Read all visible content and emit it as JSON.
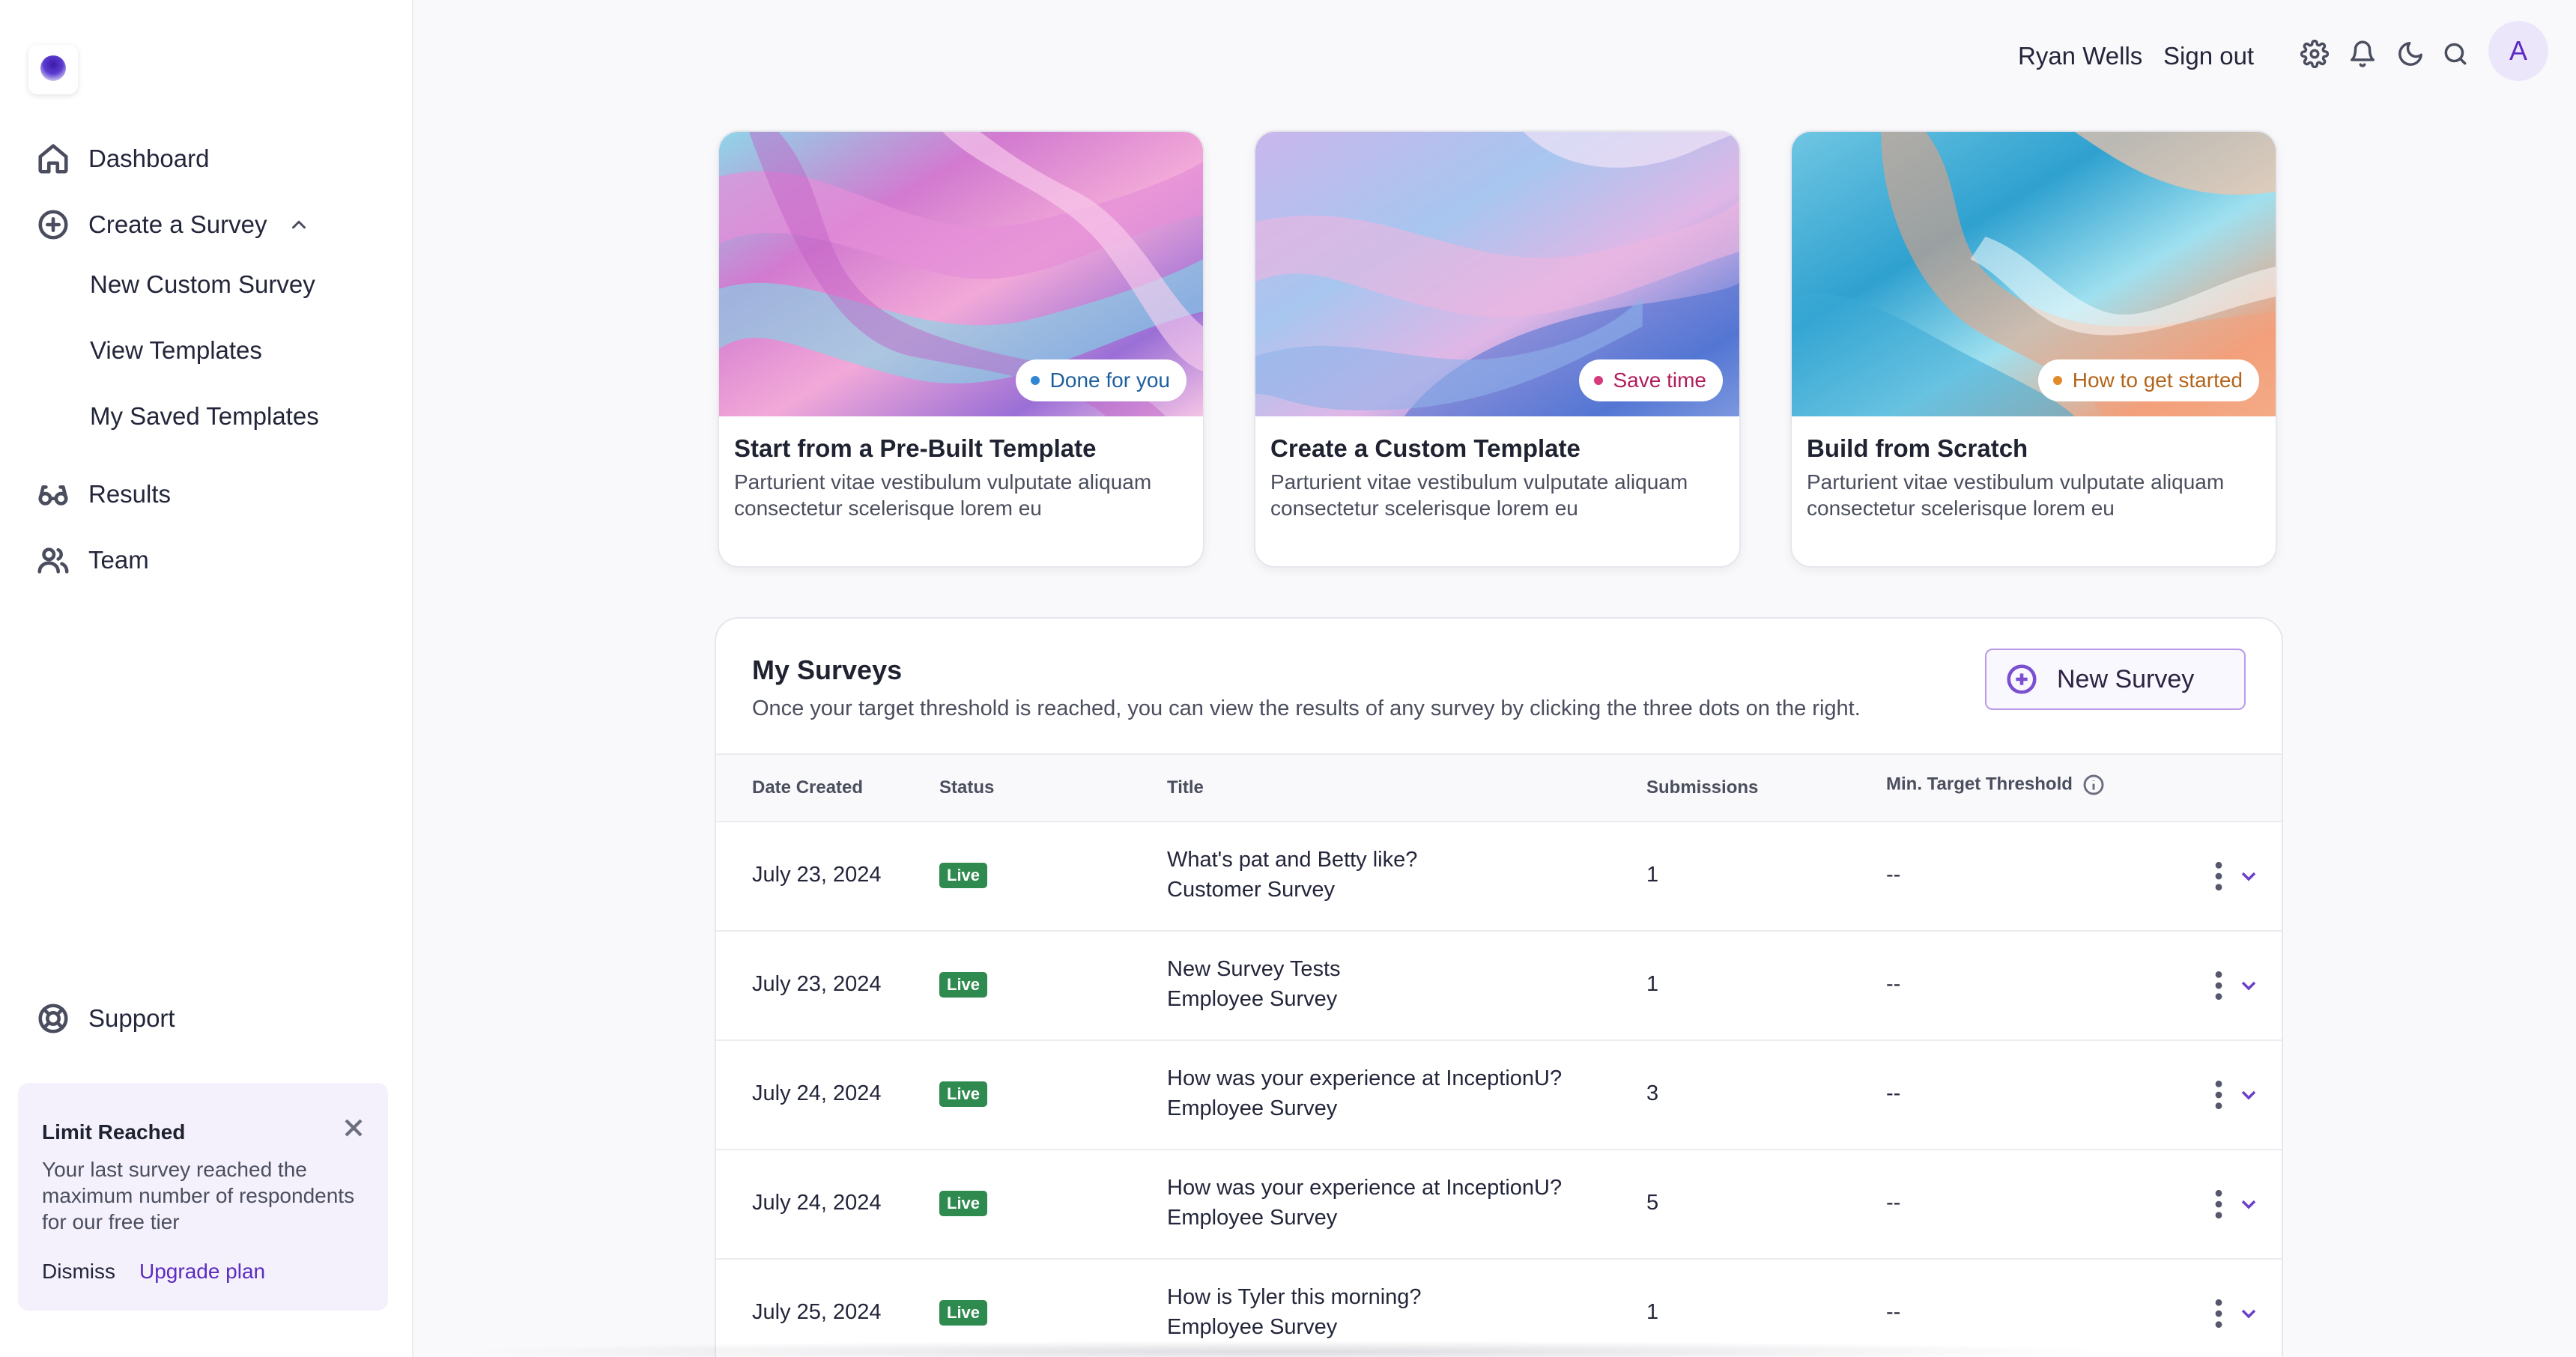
{
  "sidebar": {
    "logo_icon": "brand-orb-icon",
    "nav": [
      {
        "label": "Dashboard",
        "icon": "home-icon"
      },
      {
        "label": "Create a Survey",
        "icon": "plus-circle-icon"
      },
      {
        "label": "Results",
        "icon": "glasses-icon"
      },
      {
        "label": "Team",
        "icon": "users-icon"
      }
    ],
    "sub_nav": [
      {
        "label": "New Custom Survey"
      },
      {
        "label": "View Templates"
      },
      {
        "label": "My Saved Templates"
      }
    ],
    "support": {
      "label": "Support",
      "icon": "lifebuoy-icon"
    },
    "limit_card": {
      "title": "Limit Reached",
      "body": "Your last survey reached the maximum number of respondents for our free tier",
      "dismiss": "Dismiss",
      "upgrade": "Upgrade plan"
    }
  },
  "topbar": {
    "user_name": "Ryan Wells",
    "sign_out": "Sign out",
    "avatar_letter": "A",
    "icons": [
      "gear-icon",
      "bell-icon",
      "moon-icon",
      "search-icon"
    ]
  },
  "cards": [
    {
      "badge": "Done for you",
      "badge_color": "#2f87d6",
      "badge_text_color": "#1d5f9e",
      "title": "Start from a Pre-Built Template",
      "desc": "Parturient vitae vestibulum vulputate aliquam consectetur scelerisque lorem eu"
    },
    {
      "badge": "Save time",
      "badge_color": "#d63a7a",
      "badge_text_color": "#b01d5c",
      "title": "Create a Custom Template",
      "desc": "Parturient vitae vestibulum vulputate aliquam consectetur scelerisque lorem eu"
    },
    {
      "badge": "How to get started",
      "badge_color": "#e2892b",
      "badge_text_color": "#b3641a",
      "title": "Build from Scratch",
      "desc": "Parturient vitae vestibulum vulputate aliquam consectetur scelerisque lorem eu"
    }
  ],
  "surveys": {
    "title": "My Surveys",
    "subtitle": "Once your target threshold is reached, you can view the results of any survey by clicking the three dots on the right.",
    "new_button": "New Survey",
    "columns": [
      "Date Created",
      "Status",
      "Title",
      "Submissions",
      "Min. Target Threshold"
    ],
    "rows": [
      {
        "date": "July 23, 2024",
        "status": "Live",
        "title": "What's pat and Betty like?",
        "type": "Customer Survey",
        "submissions": "1",
        "threshold": "--"
      },
      {
        "date": "July 23, 2024",
        "status": "Live",
        "title": "New Survey Tests",
        "type": "Employee Survey",
        "submissions": "1",
        "threshold": "--"
      },
      {
        "date": "July 24, 2024",
        "status": "Live",
        "title": "How was your experience at InceptionU?",
        "type": "Employee Survey",
        "submissions": "3",
        "threshold": "--"
      },
      {
        "date": "July 24, 2024",
        "status": "Live",
        "title": "How was your experience at InceptionU?",
        "type": "Employee Survey",
        "submissions": "5",
        "threshold": "--"
      },
      {
        "date": "July 25, 2024",
        "status": "Live",
        "title": "How is Tyler this morning?",
        "type": "Employee Survey",
        "submissions": "1",
        "threshold": "--"
      }
    ]
  }
}
